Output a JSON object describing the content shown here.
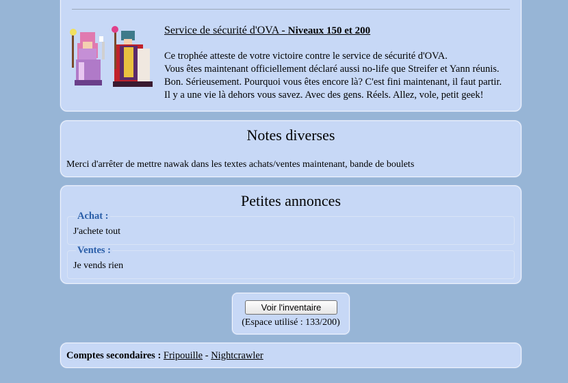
{
  "trophy": {
    "title": "Service de sécurité d'OVA - ",
    "levels": "Niveaux 150 et 200",
    "lines": [
      "Ce trophée atteste de votre victoire contre le service de sécurité d'OVA.",
      "Vous êtes maintenant officiellement déclaré aussi no-life que Streifer et Yann réunis.",
      "Bon. Sérieusement. Pourquoi vous êtes encore là? C'est fini maintenant, il faut partir.",
      "Il y a une vie là dehors vous savez. Avec des gens. Réels. Allez, vole, petit geek!"
    ],
    "image_icon": "pixel-art-sprites"
  },
  "notes": {
    "heading": "Notes diverses",
    "text": "Merci d'arrêter de mettre nawak dans les textes achats/ventes maintenant, bande de boulets"
  },
  "ads": {
    "heading": "Petites annonces",
    "buy": {
      "label": "Achat :",
      "text": "J'achete tout"
    },
    "sell": {
      "label": "Ventes :",
      "text": "Je vends rien"
    }
  },
  "inventory": {
    "button_label": "Voir l'inventaire",
    "usage": "(Espace utilisé : 133/200)"
  },
  "accounts": {
    "label": "Comptes secondaires :",
    "separator": " - ",
    "links": [
      "Fripouille",
      "Nightcrawler"
    ]
  },
  "colors": {
    "background": "#97b5d6",
    "panel": "#c7d8f6",
    "legend": "#2a5ea8"
  }
}
